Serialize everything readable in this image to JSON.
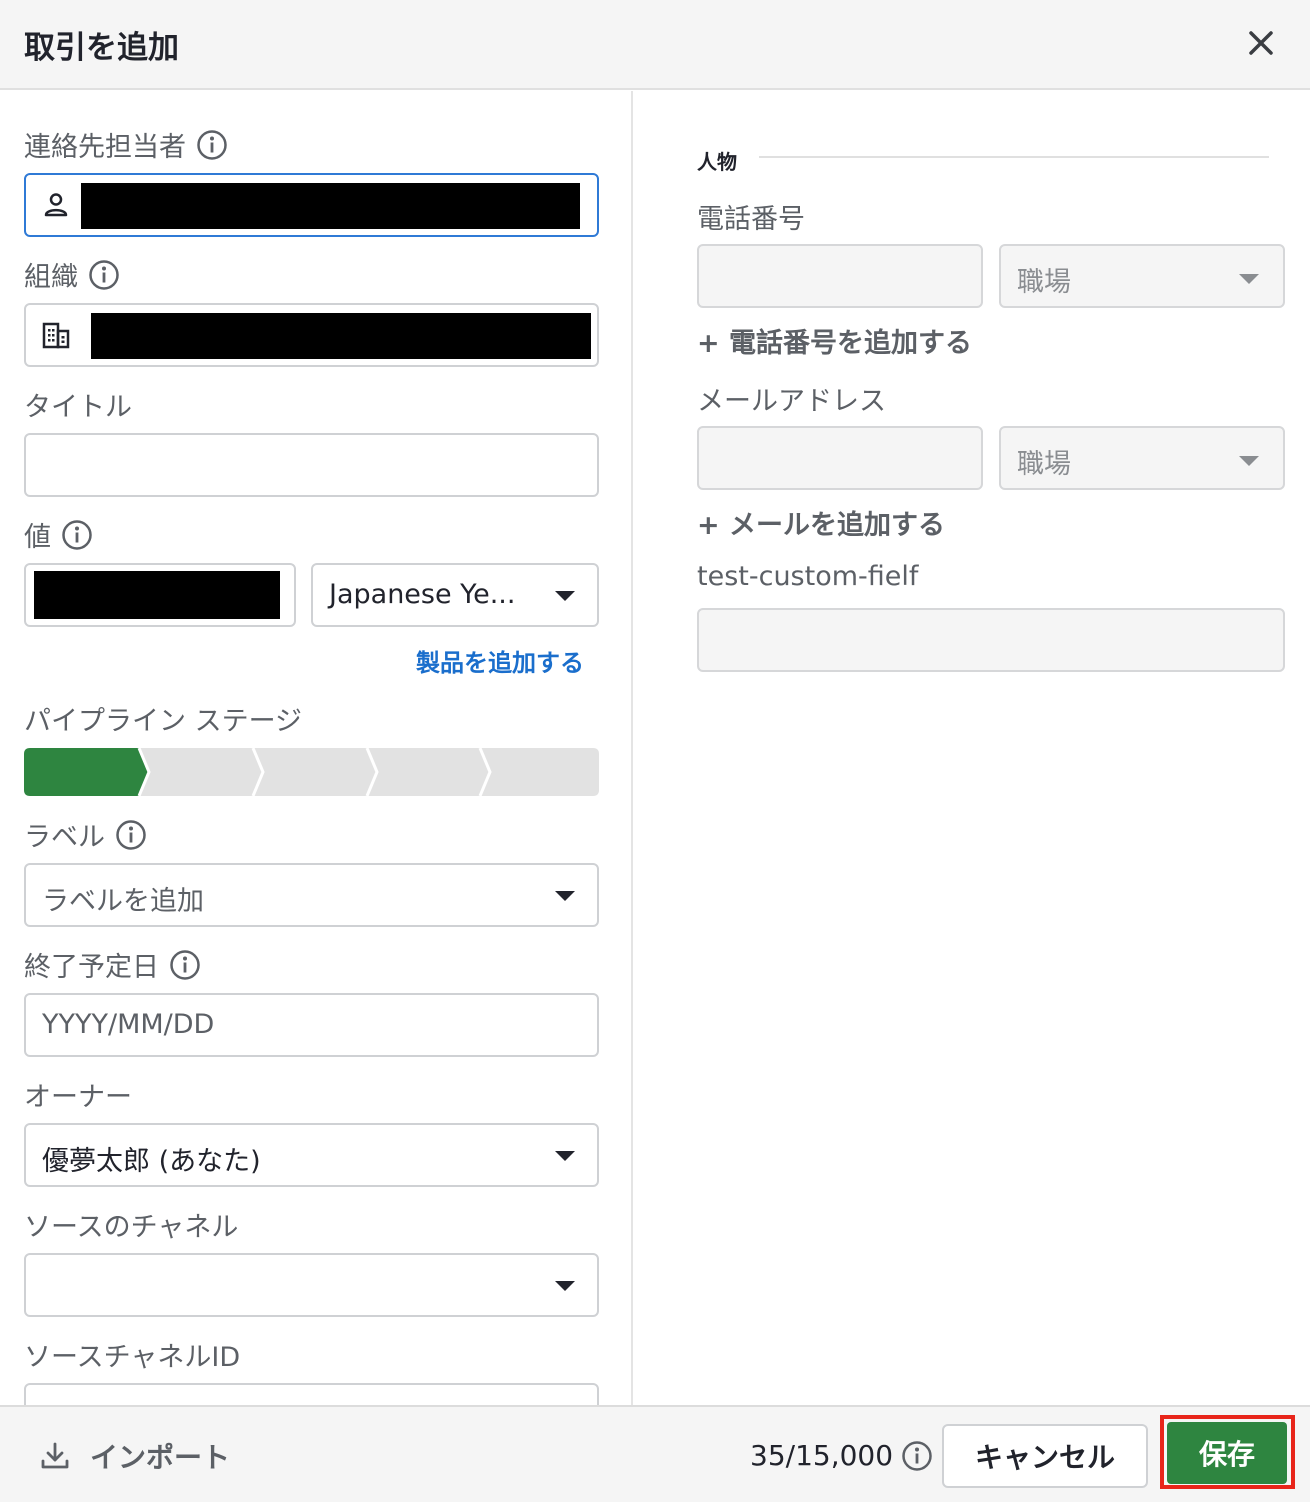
{
  "dialog": {
    "title": "取引を追加"
  },
  "form": {
    "contact_label": "連絡先担当者",
    "organization_label": "組織",
    "title_label": "タイトル",
    "value_label": "値",
    "currency_value": "Japanese Ye...",
    "add_product": "製品を追加する",
    "pipeline_label": "パイプライン ステージ",
    "pipeline": {
      "total_stages": 5,
      "active_stage": 1
    },
    "labels_label": "ラベル",
    "labels_placeholder": "ラベルを追加",
    "close_date_label": "終了予定日",
    "close_date_placeholder": "YYYY/MM/DD",
    "owner_label": "オーナー",
    "owner_value": "優夢太郎 (あなた)",
    "source_channel_label": "ソースのチャネル",
    "source_channel_value": "",
    "source_channel_id_label": "ソースチャネルID"
  },
  "person": {
    "section_title": "人物",
    "phone_label": "電話番号",
    "phone_type": "職場",
    "add_phone": "+ 電話番号を追加する",
    "email_label": "メールアドレス",
    "email_type": "職場",
    "add_email": "+ メールを追加する",
    "custom_field_label": "test-custom-fielf"
  },
  "footer": {
    "import_label": "インポート",
    "counter": "35/15,000",
    "cancel_label": "キャンセル",
    "save_label": "保存"
  },
  "colors": {
    "accent_green": "#2e8540",
    "link_blue": "#1a6ecc",
    "focus_blue": "#2f7ad6",
    "highlight_red": "#e8251a"
  }
}
